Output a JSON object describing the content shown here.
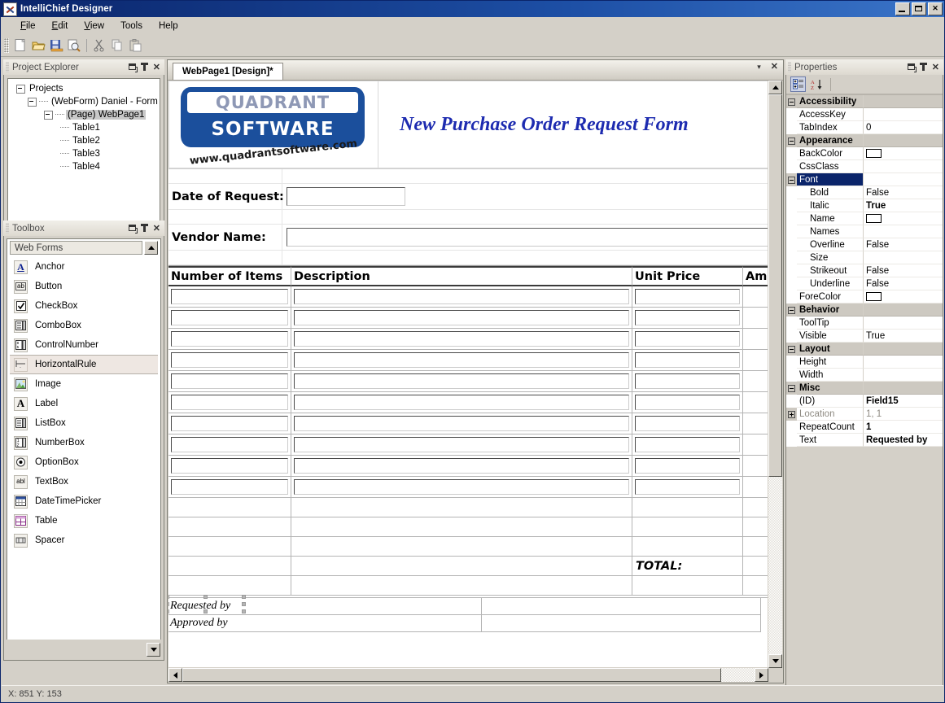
{
  "window": {
    "title": "IntelliChief Designer",
    "icon": "app-tools-icon",
    "minimize": "_",
    "maximize": "□",
    "close": "✕"
  },
  "menu": {
    "items": [
      {
        "label": "File"
      },
      {
        "label": "Edit"
      },
      {
        "label": "View"
      },
      {
        "label": "Tools"
      },
      {
        "label": "Help"
      }
    ]
  },
  "toolbar": {
    "buttons": [
      {
        "name": "new-icon",
        "glyph": "📄"
      },
      {
        "name": "open-folder-icon",
        "glyph": "📂"
      },
      {
        "name": "save-icon",
        "glyph": "💾"
      },
      {
        "name": "print-preview-icon",
        "glyph": "🔍"
      },
      {
        "name": "cut-icon",
        "glyph": "✂"
      },
      {
        "name": "copy-icon",
        "glyph": "⧉"
      },
      {
        "name": "paste-icon",
        "glyph": "📋"
      }
    ]
  },
  "project_explorer": {
    "title": "Project Explorer",
    "tree": [
      {
        "label": "Projects",
        "depth": 0,
        "expander": "minus",
        "selected": false
      },
      {
        "label": "(WebForm) Daniel - Form",
        "depth": 1,
        "expander": "minus",
        "selected": false
      },
      {
        "label": "(Page) WebPage1",
        "depth": 2,
        "expander": "minus",
        "selected": true
      },
      {
        "label": "Table1",
        "depth": 3,
        "expander": "none",
        "selected": false
      },
      {
        "label": "Table2",
        "depth": 3,
        "expander": "none",
        "selected": false
      },
      {
        "label": "Table3",
        "depth": 3,
        "expander": "none",
        "selected": false
      },
      {
        "label": "Table4",
        "depth": 3,
        "expander": "none",
        "selected": false
      }
    ]
  },
  "toolbox": {
    "title": "Toolbox",
    "category": "Web Forms",
    "items": [
      {
        "label": "Anchor",
        "icon": "anchor-letter-a-icon",
        "highlighted": false
      },
      {
        "label": "Button",
        "icon": "button-abl-icon",
        "highlighted": false
      },
      {
        "label": "CheckBox",
        "icon": "checkbox-icon",
        "highlighted": false
      },
      {
        "label": "ComboBox",
        "icon": "combobox-icon",
        "highlighted": false
      },
      {
        "label": "ControlNumber",
        "icon": "controlnumber-icon",
        "highlighted": false
      },
      {
        "label": "HorizontalRule",
        "icon": "horizontalrule-icon",
        "highlighted": true
      },
      {
        "label": "Image",
        "icon": "image-icon",
        "highlighted": false
      },
      {
        "label": "Label",
        "icon": "label-letter-a-icon",
        "highlighted": false
      },
      {
        "label": "ListBox",
        "icon": "listbox-icon",
        "highlighted": false
      },
      {
        "label": "NumberBox",
        "icon": "numberbox-icon",
        "highlighted": false
      },
      {
        "label": "OptionBox",
        "icon": "optionbox-radio-icon",
        "highlighted": false
      },
      {
        "label": "TextBox",
        "icon": "textbox-abl-icon",
        "highlighted": false
      },
      {
        "label": "DateTimePicker",
        "icon": "calendar-icon",
        "highlighted": false
      },
      {
        "label": "Table",
        "icon": "table-icon",
        "highlighted": false
      },
      {
        "label": "Spacer",
        "icon": "spacer-icon",
        "highlighted": false
      }
    ]
  },
  "document": {
    "tab_label": "WebPage1 [Design]*",
    "tab_menu_icon": "chevron-down-icon",
    "tab_close_icon": "close-icon"
  },
  "form": {
    "logo": {
      "line1": "QUADRANT",
      "line2": "SOFTWARE",
      "url": "www.quadrantsoftware.com",
      "brand_color": "#1b4f9c"
    },
    "form_title": "New Purchase Order Request Form",
    "form_title_color": "#1d2bb0",
    "fields": [
      {
        "label": "Date of Request:",
        "value": "",
        "input_width": 146
      },
      {
        "label": "Vendor Name:",
        "value": "",
        "input_width": 596
      }
    ],
    "items_table": {
      "headers": [
        "Number of Items",
        "Description",
        "Unit Price",
        "Am"
      ],
      "entry_row_count": 10,
      "blank_row_count": 3,
      "total_label": "TOTAL:",
      "rows_after_total": 1
    },
    "signature_table": {
      "rows": [
        {
          "label": "Requested by",
          "value": "",
          "selected": true
        },
        {
          "label": "Approved by",
          "value": "",
          "selected": false
        }
      ]
    }
  },
  "properties": {
    "title": "Properties",
    "toolbar": [
      {
        "name": "categorized-view-icon",
        "active": true
      },
      {
        "name": "alphabetical-sort-icon",
        "active": false
      }
    ],
    "rows": [
      {
        "kind": "category",
        "name": "Accessibility",
        "value": "",
        "expander": "minus"
      },
      {
        "kind": "prop",
        "name": "AccessKey",
        "value": "",
        "indent": 0
      },
      {
        "kind": "prop",
        "name": "TabIndex",
        "value": "0",
        "indent": 0
      },
      {
        "kind": "category",
        "name": "Appearance",
        "value": "",
        "expander": "minus"
      },
      {
        "kind": "prop",
        "name": "BackColor",
        "value": "",
        "indent": 0,
        "swatch": "#ffffff"
      },
      {
        "kind": "prop",
        "name": "CssClass",
        "value": "",
        "indent": 0
      },
      {
        "kind": "prop",
        "name": "Font",
        "value": "",
        "expander": "minus",
        "selected": true
      },
      {
        "kind": "prop",
        "name": "Bold",
        "value": "False",
        "indent": 1
      },
      {
        "kind": "prop",
        "name": "Italic",
        "value": "True",
        "indent": 1,
        "bold": true
      },
      {
        "kind": "prop",
        "name": "Name",
        "value": "",
        "indent": 1,
        "swatch": "#ffffff"
      },
      {
        "kind": "prop",
        "name": "Names",
        "value": "",
        "indent": 1
      },
      {
        "kind": "prop",
        "name": "Overline",
        "value": "False",
        "indent": 1
      },
      {
        "kind": "prop",
        "name": "Size",
        "value": "",
        "indent": 1
      },
      {
        "kind": "prop",
        "name": "Strikeout",
        "value": "False",
        "indent": 1
      },
      {
        "kind": "prop",
        "name": "Underline",
        "value": "False",
        "indent": 1
      },
      {
        "kind": "prop",
        "name": "ForeColor",
        "value": "",
        "indent": 0,
        "swatch": "#ffffff"
      },
      {
        "kind": "category",
        "name": "Behavior",
        "value": "",
        "expander": "minus"
      },
      {
        "kind": "prop",
        "name": "ToolTip",
        "value": "",
        "indent": 0
      },
      {
        "kind": "prop",
        "name": "Visible",
        "value": "True",
        "indent": 0
      },
      {
        "kind": "category",
        "name": "Layout",
        "value": "",
        "expander": "minus"
      },
      {
        "kind": "prop",
        "name": "Height",
        "value": "",
        "indent": 0
      },
      {
        "kind": "prop",
        "name": "Width",
        "value": "",
        "indent": 0
      },
      {
        "kind": "category",
        "name": "Misc",
        "value": "",
        "expander": "minus"
      },
      {
        "kind": "prop",
        "name": "(ID)",
        "value": "Field15",
        "indent": 0,
        "bold": true
      },
      {
        "kind": "prop",
        "name": "Location",
        "value": "1, 1",
        "indent": 0,
        "expander": "plus",
        "dim": true
      },
      {
        "kind": "prop",
        "name": "RepeatCount",
        "value": "1",
        "indent": 0,
        "bold": true
      },
      {
        "kind": "prop",
        "name": "Text",
        "value": "Requested by",
        "indent": 0,
        "bold": true
      }
    ]
  },
  "panel_buttons": {
    "window_icon": "restore-window-icon",
    "pin_icon": "pin-icon",
    "close_icon": "close-icon"
  },
  "statusbar": {
    "coords": "X: 851 Y: 153"
  }
}
